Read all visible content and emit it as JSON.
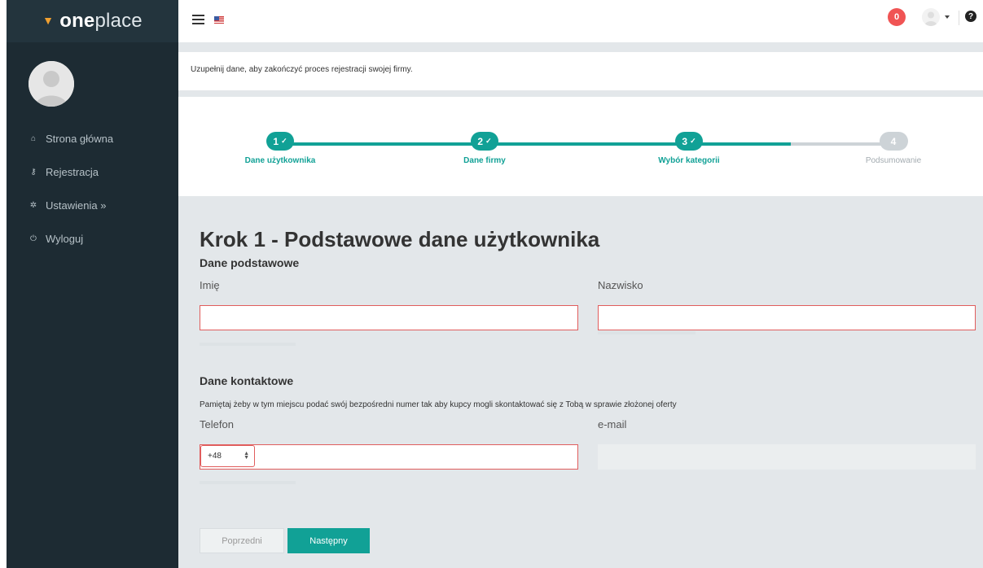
{
  "sidebar": {
    "logo_bold": "one",
    "logo_light": "place",
    "nav": [
      {
        "label": "Strona główna",
        "icon": "home-icon"
      },
      {
        "label": "Rejestracja",
        "icon": "key-icon"
      },
      {
        "label": "Ustawienia »",
        "icon": "gear-icon"
      },
      {
        "label": "Wyloguj",
        "icon": "power-icon"
      }
    ]
  },
  "topbar": {
    "notifications": "0"
  },
  "info": {
    "text": "Uzupełnij dane, aby zakończyć proces rejestracji swojej firmy."
  },
  "stepper": {
    "steps": [
      {
        "num": "1",
        "label": "Dane użytkownika",
        "done": true
      },
      {
        "num": "2",
        "label": "Dane firmy",
        "done": true
      },
      {
        "num": "3",
        "label": "Wybór kategorii",
        "done": true
      },
      {
        "num": "4",
        "label": "Podsumowanie",
        "done": false
      }
    ],
    "check": "✓"
  },
  "form": {
    "title_bold": "Krok 1 -",
    "title_rest": "Podstawowe dane użytkownika",
    "basic": {
      "prefix": "Dane",
      "strong": "podstawowe"
    },
    "first_name": {
      "label": "Imię",
      "value": ""
    },
    "last_name": {
      "label": "Nazwisko",
      "value": ""
    },
    "contact": {
      "prefix": "Dane",
      "strong": "kontaktowe"
    },
    "contact_note": "Pamiętaj żeby w tym miejscu podać swój bezpośredni numer tak aby kupcy mogli skontaktować się z Tobą w sprawie złożonej oferty",
    "phone": {
      "label": "Telefon",
      "prefix": "+48",
      "value": ""
    },
    "email": {
      "label": "e-mail",
      "value": ""
    },
    "prev_button": "Poprzedni",
    "next_button": "Następny"
  },
  "colors": {
    "accent": "#11a196",
    "sidebar": "#1d2b33",
    "error_border": "#e05d5d",
    "badge": "#f05454"
  }
}
